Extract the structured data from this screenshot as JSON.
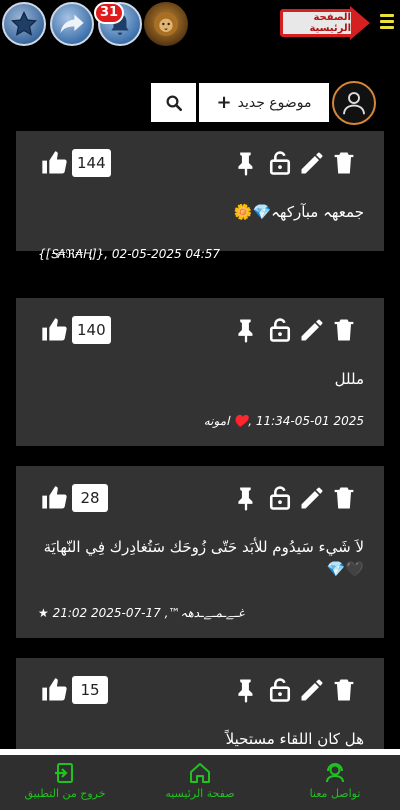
{
  "header": {
    "notification_count": "31",
    "home_banner_label": "الصفحة الرئيسية",
    "icons": [
      "star-icon",
      "share-icon",
      "bell-icon",
      "lion-avatar-icon",
      "hamburger-icon"
    ]
  },
  "toolbar": {
    "new_topic_label": "موضوع جديد",
    "new_topic_icon": "+"
  },
  "posts": [
    {
      "likes": "144",
      "title": "جمعهہ مبآرکهہ💎🌼",
      "meta": "{[Ꭶ₳ℜ₳Ⱨ]}, 02-05-2025 04:57"
    },
    {
      "likes": "140",
      "title": "مللل",
      "meta": "2025 11:34-05-01 ,♥️ امونه"
    },
    {
      "likes": "28",
      "title": "لاَ شَيء سَيدُوم للأبَد حَتّى زُوحَك سَتُغادِرك فِي النّهايَة 🖤💎",
      "meta": "★ غـﮯـمـﮯـدهہ™, 17-07-2025 21:02"
    },
    {
      "likes": "15",
      "title": "هل كان اللقاء مستحيلاً",
      "meta": ""
    }
  ],
  "bottom_nav": {
    "exit_label": "خروج من التطبيق",
    "home_label": "صفحة الرئيسيه",
    "contact_label": "تواصل معنا"
  },
  "colors": {
    "background": "#000000",
    "card": "#333333",
    "nav_accent": "#1fc21f",
    "badge": "#e01b1b",
    "banner_red": "#d42020"
  }
}
